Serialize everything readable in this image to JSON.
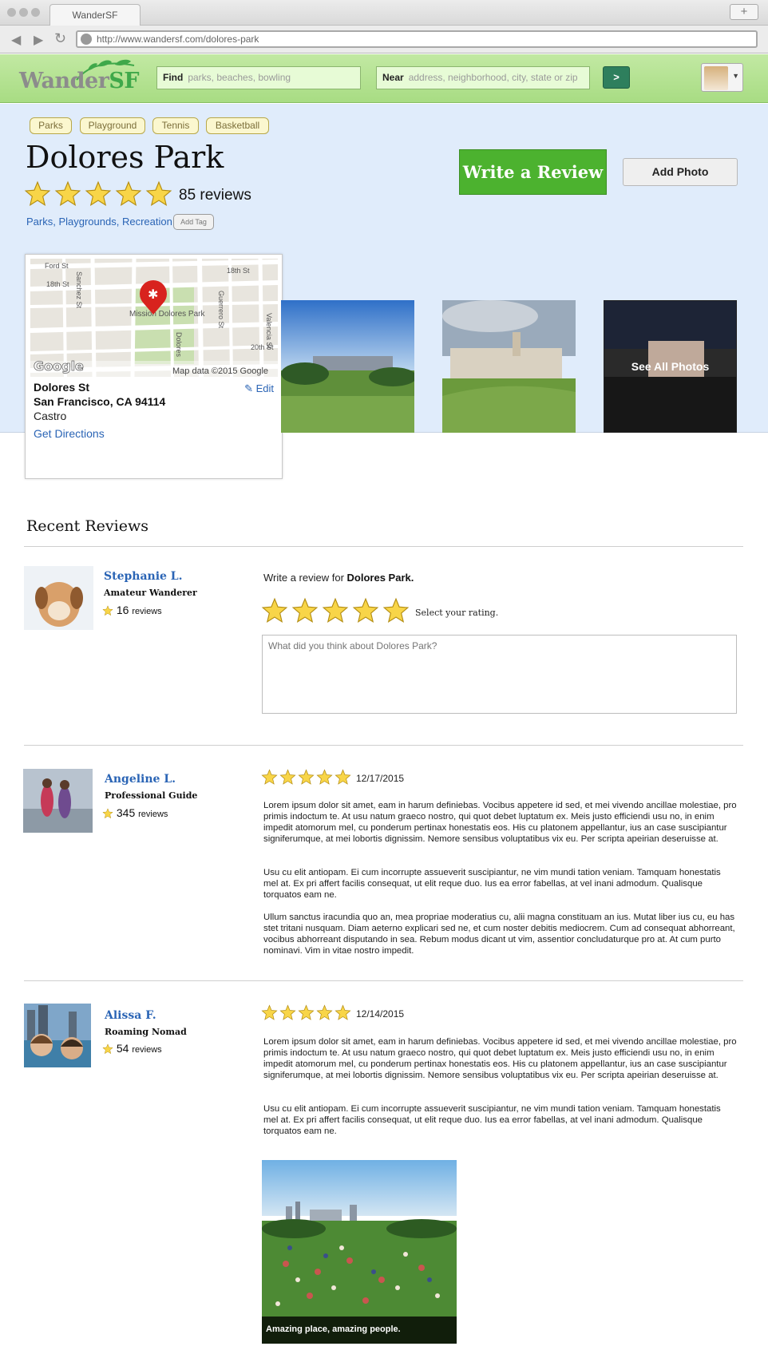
{
  "browser": {
    "tab_title": "WanderSF",
    "new_tab": "+",
    "url": "http://www.wandersf.com/dolores-park"
  },
  "header": {
    "logo_wander": "Wander",
    "logo_sf": "SF",
    "find_label": "Find",
    "find_placeholder": "parks, beaches, bowling",
    "near_label": "Near",
    "near_placeholder": "address, neighborhood, city, state or zip",
    "go_label": ">"
  },
  "place": {
    "tags": [
      "Parks",
      "Playground",
      "Tennis",
      "Basketball"
    ],
    "name": "Dolores Park",
    "rating": 5,
    "review_count": "85 reviews",
    "categories": "Parks, Playgrounds, Recreation",
    "add_tag": "Add Tag",
    "write_review": "Write a Review",
    "add_photo": "Add Photo"
  },
  "location": {
    "street": "Dolores St",
    "city": "San Francisco, CA 94114",
    "neighborhood": "Castro",
    "directions": "Get Directions",
    "edit": "Edit",
    "map_labels": {
      "ford": "Ford St",
      "st18_left": "18th St",
      "st18_right": "18th St",
      "sanchez": "Sanchez St",
      "guerrero": "Guerrero St",
      "valencia": "Valencia St",
      "st20": "20th St",
      "dolores": "Dolores",
      "mission_dolores_park": "Mission Dolores Park",
      "google": "Google",
      "attribution": "Map data ©2015 Google"
    }
  },
  "photos": {
    "see_all": "See All Photos"
  },
  "reviews_section": {
    "title": "Recent Reviews"
  },
  "write_review": {
    "user": {
      "name": "Stephanie L.",
      "role": "Amateur Wanderer",
      "count": "16",
      "count_label": "reviews"
    },
    "prompt_prefix": "Write a review for",
    "prompt_place": "Dolores Park.",
    "select_rating": "Select your rating.",
    "textarea_placeholder": "What did you think about Dolores Park?"
  },
  "reviews": [
    {
      "name": "Angeline L.",
      "role": "Professional Guide",
      "count": "345",
      "count_label": "reviews",
      "rating": 5,
      "date": "12/17/2015",
      "paragraphs": [
        "Lorem ipsum dolor sit amet, eam in harum definiebas. Vocibus appetere id sed, et mei vivendo ancillae molestiae, pro primis indoctum te. At usu natum graeco nostro, qui quot debet luptatum ex. Meis justo efficiendi usu no, in enim impedit atomorum mel, cu ponderum pertinax honestatis eos. His cu platonem appellantur, ius an case suscipiantur signiferumque, at mei lobortis dignissim. Nemore sensibus voluptatibus vix eu. Per scripta apeirian deseruisse at.",
        "Usu cu elit antiopam. Ei cum incorrupte assueverit suscipiantur, ne vim mundi tation veniam. Tamquam honestatis mel at. Ex pri affert facilis consequat, ut elit reque duo. Ius ea error fabellas, at vel inani admodum. Qualisque torquatos eam ne.",
        "Ullum sanctus iracundia quo an, mea propriae moderatius cu, alii magna constituam an ius. Mutat liber ius cu, eu has stet tritani nusquam. Diam aeterno explicari sed ne, et cum noster debitis mediocrem. Cum ad consequat abhorreant, vocibus abhorreant disputando in sea. Rebum modus dicant ut vim, assentior concludaturque pro at. At cum purto nominavi. Vim in vitae nostro impedit."
      ]
    },
    {
      "name": "Alissa F.",
      "role": "Roaming Nomad",
      "count": "54",
      "count_label": "reviews",
      "rating": 5,
      "date": "12/14/2015",
      "paragraphs": [
        "Lorem ipsum dolor sit amet, eam in harum definiebas. Vocibus appetere id sed, et mei vivendo ancillae molestiae, pro primis indoctum te. At usu natum graeco nostro, qui quot debet luptatum ex. Meis justo efficiendi usu no, in enim impedit atomorum mel, cu ponderum pertinax honestatis eos. His cu platonem appellantur, ius an case suscipiantur signiferumque, at mei lobortis dignissim. Nemore sensibus voluptatibus vix eu. Per scripta apeirian deseruisse at.",
        "Usu cu elit antiopam. Ei cum incorrupte assueverit suscipiantur, ne vim mundi tation veniam. Tamquam honestatis mel at. Ex pri affert facilis consequat, ut elit reque duo. Ius ea error fabellas, at vel inani admodum. Qualisque torquatos eam ne."
      ],
      "photo_caption": "Amazing place, amazing people."
    }
  ],
  "colors": {
    "accent_green": "#4cb22f",
    "link_blue": "#2a64b5",
    "hero_bg": "#e0ecfb",
    "star_fill": "#f8d548"
  }
}
